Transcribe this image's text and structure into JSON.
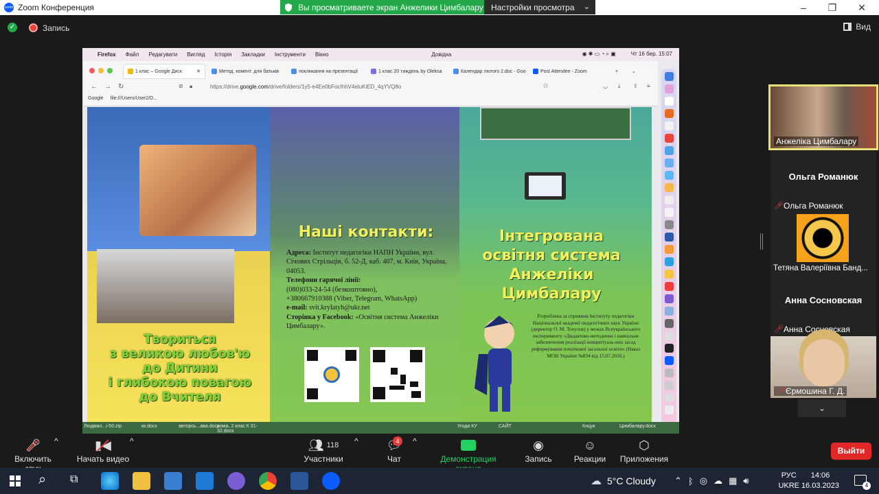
{
  "window": {
    "title": "Zoom Конференция",
    "share_banner": "Вы просматриваете экран Анжелики Цимбалару",
    "view_options": "Настройки просмотра"
  },
  "top_strip": {
    "record_label": "Запись",
    "view_label": "Вид"
  },
  "mac_menubar": {
    "items": [
      "Firefox",
      "Файл",
      "Редагувати",
      "Вигляд",
      "Історія",
      "Закладки",
      "Інструменти",
      "Вікно",
      "Довідка"
    ],
    "clock": "Чт 16 бер.  15:07"
  },
  "browser": {
    "tabs": [
      "1 клас – Google Диск",
      "Метод. комент. для батьків",
      "покликання на презентації",
      "1 клас 20 тиждень by Oleksa",
      "Календар лютого 2.doc - Goo",
      "Post Attendee - Zoom"
    ],
    "url_prefix": "https://drive.",
    "url_domain": "google.com",
    "url_rest": "/drive/folders/1y5-e4Ee0bFocIhhV4eluKiED_4qYVQ8o",
    "bookmarks": [
      "Google",
      "file:///Users/User2/D..."
    ]
  },
  "brochure": {
    "slogan": [
      "Твориться",
      "з великою любов'ю",
      "до Дитини",
      "і глибокою повагою",
      "до Вчителя"
    ],
    "contacts_heading": "Наші контакти:",
    "address_label": "Адреса:",
    "address": "Інститут педагогіки НАПН України, вул. Січових Стрільців, б. 52-Д, каб. 407, м. Київ, Україна, 04053.",
    "hotline_label": "Телефони гарячої лінії:",
    "hotline1": "(080)033-24-54 (безкоштовно),",
    "hotline2": "+380667910388 (Viber, Telegram, WhatsApp)",
    "email_label": "e-mail:",
    "email": "svit.krylatyh@ukr.net",
    "facebook_label": "Сторінка у Facebook:",
    "facebook": "«Освітня система Анжеліки Цимбалару».",
    "title_lines": [
      "Інтегрована",
      "освітня система",
      "Анжеліки",
      "Цимбалару"
    ],
    "credits": "Розроблена за сприяння Інституту педагогіки Національної академії педагогічних наук України (директор О. М. Топузов) у межах Всеукраїнського експерименту «Дидактико-методичне і навчальне забезпечення реалізації концептуаль-них засад реформування початкової загальної освіти» (Наказ МОН України №834 від 15.07.2016.)"
  },
  "desktop_labels": [
    "Людмил...і-50.zip",
    "кк.docx",
    "авторсь...ава.docx",
    "рома, 2 клас К 31-32.docx",
    "Угоди КУ",
    "САЙТ",
    "Кнцук",
    "Цимбалару.docx"
  ],
  "participants": [
    {
      "name": "Анжеліка Цимбалару",
      "muted": false
    },
    {
      "name": "Ольга Романюк",
      "muted": true
    },
    {
      "name": "Тетяна Валеріївна Банд...",
      "muted": false
    },
    {
      "name": "Анна Сосновская",
      "muted": true
    },
    {
      "name": "Єрмошина Г. Д.",
      "muted": true
    }
  ],
  "toolbar": {
    "unmute": "Включить звук",
    "start_video": "Начать видео",
    "participants": "Участники",
    "participants_count": "118",
    "chat": "Чат",
    "chat_badge": "4",
    "share": "Демонстрация экрана",
    "record": "Запись",
    "reactions": "Реакции",
    "apps": "Приложения",
    "leave": "Выйти"
  },
  "taskbar": {
    "weather": "5°C  Cloudy",
    "lang1": "РУС",
    "lang2": "UKRE",
    "time": "14:06",
    "date": "16.03.2023",
    "notifications": "4"
  },
  "colors": {
    "banner_green": "#23a94a",
    "leave_red": "#e02828",
    "share_green": "#23d160"
  }
}
